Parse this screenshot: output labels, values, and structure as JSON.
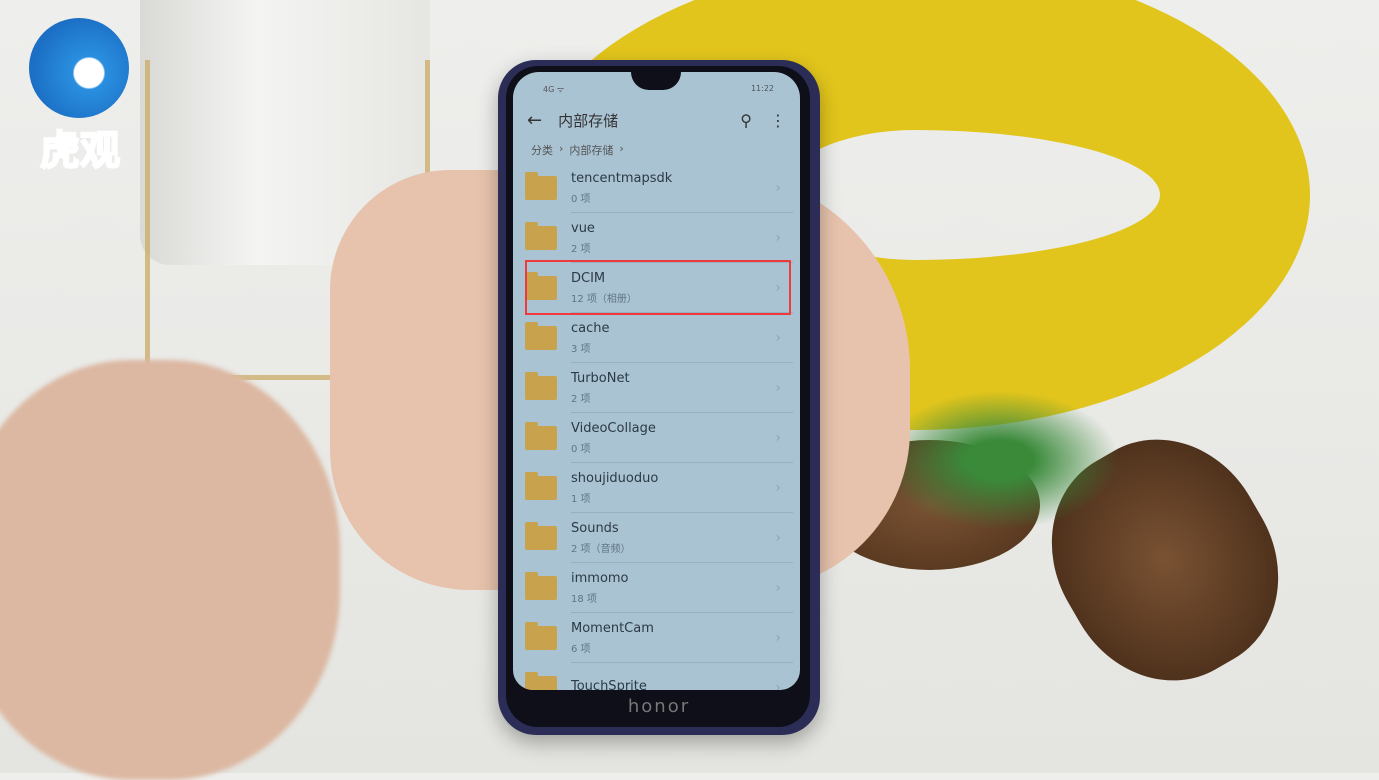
{
  "logo": {
    "text": "虎观"
  },
  "phone": {
    "brand": "honor",
    "status": {
      "left": "4G ᯤ",
      "time": "11:22"
    }
  },
  "appbar": {
    "title": "内部存储",
    "back_icon": "arrow-left-icon",
    "search_icon": "search-icon",
    "more_icon": "more-vertical-icon"
  },
  "breadcrumb": [
    {
      "label": "分类"
    },
    {
      "label": "内部存储"
    }
  ],
  "folders": [
    {
      "name": "tencentmapsdk",
      "sub": "0 项"
    },
    {
      "name": "vue",
      "sub": "2 项"
    },
    {
      "name": "DCIM",
      "sub": "12 项（相册）",
      "highlighted": true
    },
    {
      "name": "cache",
      "sub": "3 项"
    },
    {
      "name": "TurboNet",
      "sub": "2 项"
    },
    {
      "name": "VideoCollage",
      "sub": "0 项"
    },
    {
      "name": "shoujiduoduo",
      "sub": "1 项"
    },
    {
      "name": "Sounds",
      "sub": "2 项（音频）"
    },
    {
      "name": "immomo",
      "sub": "18 项"
    },
    {
      "name": "MomentCam",
      "sub": "6 项"
    },
    {
      "name": "TouchSprite",
      "sub": ""
    }
  ],
  "colors": {
    "highlight": "#ee3a3a",
    "folder": "#c9a24d",
    "logo": "#2a8fe0"
  }
}
